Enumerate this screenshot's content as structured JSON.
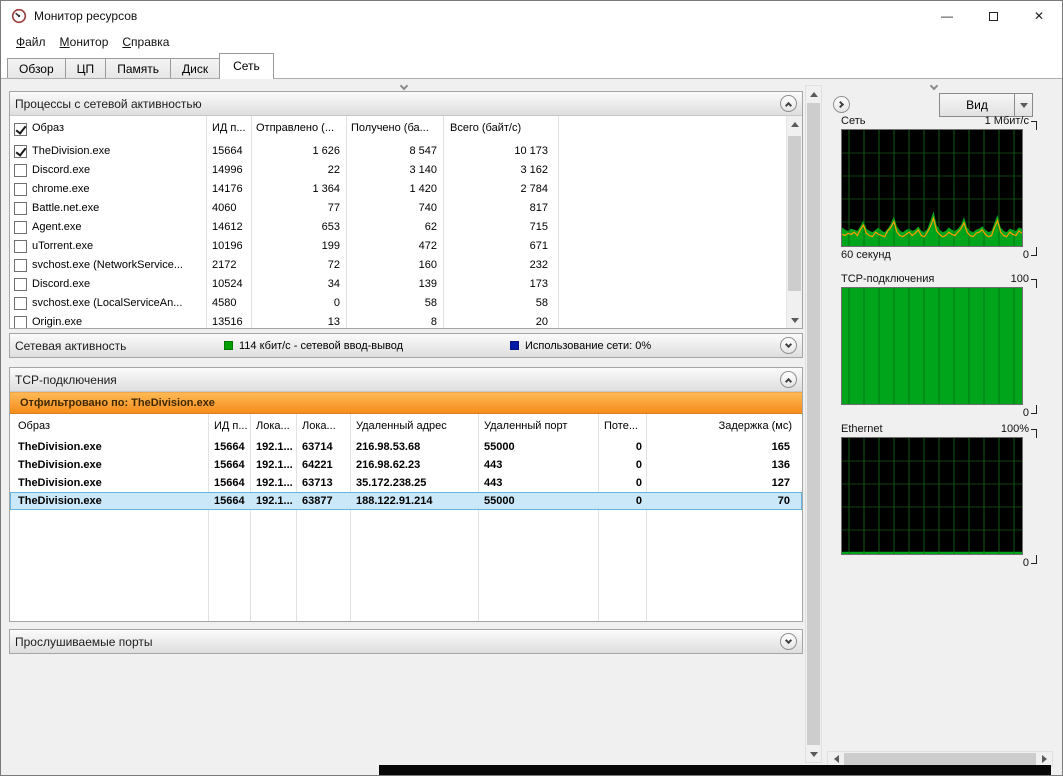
{
  "window": {
    "title": "Монитор ресурсов",
    "controls": {
      "minimize": "—",
      "close": "✕"
    }
  },
  "menu": {
    "items": [
      {
        "label": "Файл"
      },
      {
        "label": "Монитор"
      },
      {
        "label": "Справка"
      }
    ]
  },
  "tabs": [
    {
      "label": "Обзор",
      "active": false
    },
    {
      "label": "ЦП",
      "active": false
    },
    {
      "label": "Память",
      "active": false
    },
    {
      "label": "Диск",
      "active": false
    },
    {
      "label": "Сеть",
      "active": true
    }
  ],
  "processes_panel": {
    "title": "Процессы с сетевой активностью",
    "columns": [
      "Образ",
      "ИД п...",
      "Отправлено (...",
      "Получено (ба...",
      "Всего (байт/с)"
    ],
    "rows": [
      {
        "checked": true,
        "name": "TheDivision.exe",
        "pid": "15664",
        "sent": "1 626",
        "received": "8 547",
        "total": "10 173"
      },
      {
        "checked": false,
        "name": "Discord.exe",
        "pid": "14996",
        "sent": "22",
        "received": "3 140",
        "total": "3 162"
      },
      {
        "checked": false,
        "name": "chrome.exe",
        "pid": "14176",
        "sent": "1 364",
        "received": "1 420",
        "total": "2 784"
      },
      {
        "checked": false,
        "name": "Battle.net.exe",
        "pid": "4060",
        "sent": "77",
        "received": "740",
        "total": "817"
      },
      {
        "checked": false,
        "name": "Agent.exe",
        "pid": "14612",
        "sent": "653",
        "received": "62",
        "total": "715"
      },
      {
        "checked": false,
        "name": "uTorrent.exe",
        "pid": "10196",
        "sent": "199",
        "received": "472",
        "total": "671"
      },
      {
        "checked": false,
        "name": "svchost.exe (NetworkService...",
        "pid": "2172",
        "sent": "72",
        "received": "160",
        "total": "232"
      },
      {
        "checked": false,
        "name": "Discord.exe",
        "pid": "10524",
        "sent": "34",
        "received": "139",
        "total": "173"
      },
      {
        "checked": false,
        "name": "svchost.exe (LocalServiceAn...",
        "pid": "4580",
        "sent": "0",
        "received": "58",
        "total": "58"
      },
      {
        "checked": false,
        "name": "Origin.exe",
        "pid": "13516",
        "sent": "13",
        "received": "8",
        "total": "20"
      }
    ]
  },
  "network_activity_panel": {
    "title": "Сетевая активность",
    "io_legend": "114 кбит/с - сетевой ввод-вывод",
    "io_color": "#00a000",
    "usage_legend": "Использование сети: 0%",
    "usage_color": "#0018a8"
  },
  "tcp_panel": {
    "title": "TCP-подключения",
    "filter_text": "Отфильтровано по: TheDivision.exe",
    "columns": [
      "Образ",
      "ИД п...",
      "Лока...",
      "Лока...",
      "Удаленный адрес",
      "Удаленный порт",
      "Поте...",
      "Задержка (мс)"
    ],
    "rows": [
      {
        "name": "TheDivision.exe",
        "pid": "15664",
        "local_addr": "192.1...",
        "local_port": "63714",
        "remote_addr": "216.98.53.68",
        "remote_port": "55000",
        "losses": "0",
        "latency": "165",
        "selected": false
      },
      {
        "name": "TheDivision.exe",
        "pid": "15664",
        "local_addr": "192.1...",
        "local_port": "64221",
        "remote_addr": "216.98.62.23",
        "remote_port": "443",
        "losses": "0",
        "latency": "136",
        "selected": false
      },
      {
        "name": "TheDivision.exe",
        "pid": "15664",
        "local_addr": "192.1...",
        "local_port": "63713",
        "remote_addr": "35.172.238.25",
        "remote_port": "443",
        "losses": "0",
        "latency": "127",
        "selected": false
      },
      {
        "name": "TheDivision.exe",
        "pid": "15664",
        "local_addr": "192.1...",
        "local_port": "63877",
        "remote_addr": "188.122.91.214",
        "remote_port": "55000",
        "losses": "0",
        "latency": "70",
        "selected": true
      }
    ]
  },
  "ports_panel": {
    "title": "Прослушиваемые порты"
  },
  "sidebar": {
    "view_button": "Вид",
    "charts": [
      {
        "title": "Сеть",
        "max_label": "1 Мбит/с",
        "min_label": "0",
        "footer": "60 секунд",
        "bg": "#000000",
        "grid": "#1c741c",
        "fill_color": "#00a51b",
        "line_color": "#ff9d00",
        "fill": [
          16,
          14,
          13,
          15,
          14,
          13,
          17,
          22,
          15,
          13,
          12,
          14,
          16,
          13,
          12,
          15,
          19,
          26,
          17,
          13,
          12,
          14,
          15,
          13,
          14,
          17,
          13,
          12,
          15,
          22,
          30,
          18,
          14,
          12,
          13,
          16,
          14,
          13,
          15,
          18,
          25,
          16,
          13,
          12,
          14,
          15,
          17,
          14,
          12,
          13,
          20,
          27,
          16,
          13,
          12,
          15,
          14,
          13,
          16,
          15
        ],
        "line": [
          10,
          9,
          11,
          10,
          12,
          9,
          14,
          18,
          11,
          9,
          8,
          12,
          10,
          9,
          8,
          13,
          16,
          21,
          12,
          9,
          8,
          10,
          12,
          9,
          11,
          14,
          9,
          8,
          12,
          17,
          24,
          13,
          10,
          8,
          9,
          12,
          10,
          9,
          12,
          15,
          20,
          12,
          9,
          8,
          11,
          12,
          14,
          10,
          8,
          9,
          16,
          22,
          12,
          9,
          8,
          12,
          10,
          9,
          13,
          11
        ]
      },
      {
        "title": "TCP-подключения",
        "max_label": "100",
        "min_label": "0",
        "bg": "#000000",
        "grid": "#0b5c0b",
        "fill_color": "#00a51b",
        "fill": [
          100,
          100,
          100,
          100,
          100,
          100,
          100,
          100,
          100,
          100,
          100,
          100,
          100,
          100,
          100,
          100,
          100,
          100,
          100,
          100,
          100,
          100,
          100,
          100,
          100,
          100,
          100,
          100,
          100,
          100,
          100,
          100,
          100,
          100,
          100,
          100,
          100,
          100,
          100,
          100
        ]
      },
      {
        "title": "Ethernet",
        "max_label": "100%",
        "min_label": "0",
        "bg": "#000000",
        "grid": "#1c741c",
        "fill_color": "#00a51b",
        "fill": [
          2,
          2,
          2,
          2,
          2,
          2,
          2,
          2,
          2,
          2,
          2,
          2,
          2,
          2,
          2,
          2,
          2,
          2,
          2,
          2,
          2,
          2,
          2,
          2,
          2,
          2,
          2,
          2,
          2,
          2,
          2,
          2,
          2,
          2,
          2,
          2,
          2,
          2,
          2,
          2
        ]
      }
    ]
  }
}
